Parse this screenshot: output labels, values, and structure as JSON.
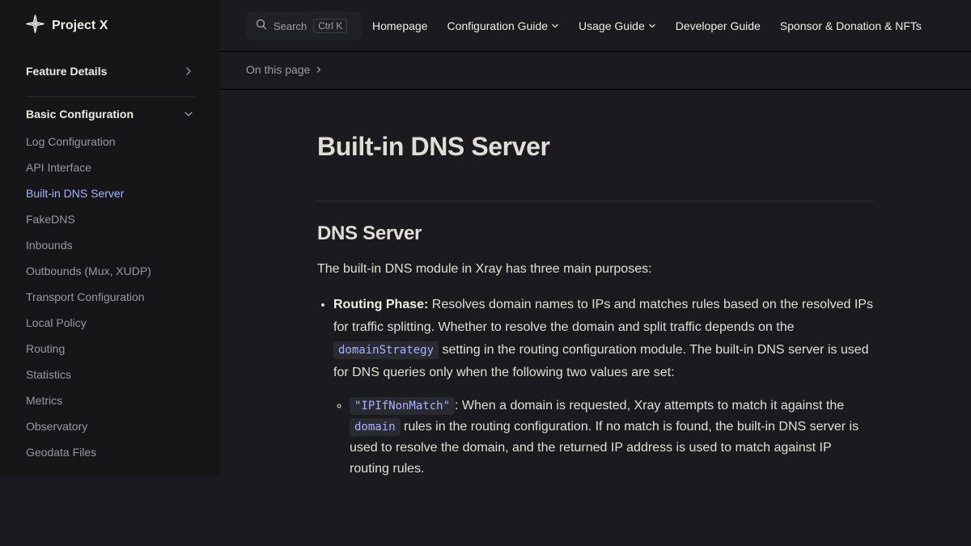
{
  "brand": {
    "name": "Project X",
    "icon": "sparkle-logo-icon"
  },
  "sidebar": {
    "feature_group": "Feature Details",
    "basic_group": "Basic Configuration",
    "items": [
      {
        "label": "Log Configuration",
        "active": false
      },
      {
        "label": "API Interface",
        "active": false
      },
      {
        "label": "Built-in DNS Server",
        "active": true
      },
      {
        "label": "FakeDNS",
        "active": false
      },
      {
        "label": "Inbounds",
        "active": false
      },
      {
        "label": "Outbounds (Mux, XUDP)",
        "active": false
      },
      {
        "label": "Transport Configuration",
        "active": false
      },
      {
        "label": "Local Policy",
        "active": false
      },
      {
        "label": "Routing",
        "active": false
      },
      {
        "label": "Statistics",
        "active": false
      },
      {
        "label": "Metrics",
        "active": false
      },
      {
        "label": "Observatory",
        "active": false
      },
      {
        "label": "Geodata Files",
        "active": false
      }
    ]
  },
  "topnav": {
    "search_label": "Search",
    "search_kbd": "Ctrl K",
    "items": [
      {
        "label": "Homepage",
        "dropdown": false
      },
      {
        "label": "Configuration Guide",
        "dropdown": true
      },
      {
        "label": "Usage Guide",
        "dropdown": true
      },
      {
        "label": "Developer Guide",
        "dropdown": false
      },
      {
        "label": "Sponsor & Donation & NFTs",
        "dropdown": false
      }
    ]
  },
  "localnav": {
    "on_this_page": "On this page"
  },
  "content": {
    "title": "Built-in DNS Server",
    "section_title": "DNS Server",
    "intro": "The built-in DNS module in Xray has three main purposes:",
    "routing_phase": {
      "label": "Routing Phase:",
      "text1": " Resolves domain names to IPs and matches rules based on the resolved IPs for traffic splitting. Whether to resolve the domain and split traffic depends on the ",
      "code": "domainStrategy",
      "text2": " setting in the routing configuration module. The built-in DNS server is used for DNS queries only when the following two values are set:"
    },
    "ipifnonmatch": {
      "code": "\"IPIfNonMatch\"",
      "text1": ": When a domain is requested, Xray attempts to match it against the ",
      "code2": "domain",
      "text2": " rules in the routing configuration. If no match is found, the built-in DNS server is used to resolve the domain, and the returned IP address is used to match against IP routing rules."
    }
  },
  "colors": {
    "background": "#1b1b1f",
    "sidebar": "#161618",
    "accent": "#a8b1ff",
    "code_bg": "#2a2b32"
  }
}
